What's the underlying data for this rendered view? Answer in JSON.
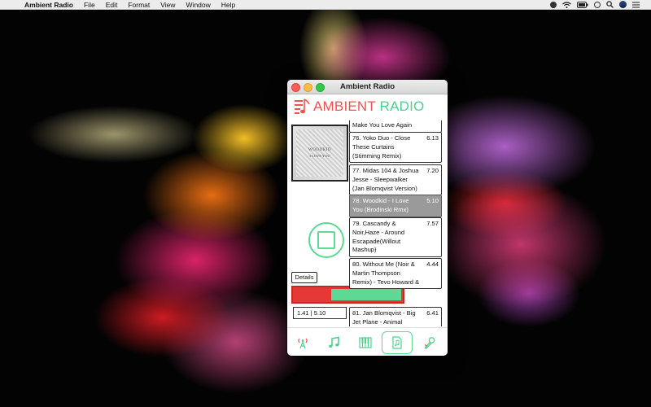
{
  "menubar": {
    "apple_glyph": "",
    "app_name": "Ambient Radio",
    "items": [
      "File",
      "Edit",
      "Format",
      "View",
      "Window",
      "Help"
    ]
  },
  "window": {
    "title": "Ambient Radio",
    "logo_word1": "AMBIENT",
    "logo_word2": "RADIO"
  },
  "player": {
    "album_art_artist": "WOODKID",
    "album_art_title": "I LOVE YOU",
    "details_label": "Details",
    "progress_fraction": 0.344,
    "time_display": "1.41 | 5.10"
  },
  "tracks": [
    {
      "title": "Make You Love Again",
      "length": ""
    },
    {
      "title": "76. Yoko Duo - Close These Curtains (Stimming Remix)",
      "length": "6.13"
    },
    {
      "title": "77. Midas 104 & Joshua Jesse - Sleepwalker (Jan Blomqvist Version)",
      "length": "7.20"
    },
    {
      "title": "78. Woodkid - I Love You (Brodinski Rmx)",
      "length": "5.10",
      "active": true
    },
    {
      "title": "79. Cascandy & Noir,Haze - Around Escapade(Willout Mashup)",
      "length": "7.57"
    },
    {
      "title": "80. Without Me (Noir & Martin Thompson Remix) - Tevo Howard &",
      "length": "4.44"
    },
    {
      "title": "81. Jan Blomqvist - Big Jet Plane - Animal",
      "length": "6.41"
    }
  ],
  "colors": {
    "accent_green": "#5fd894",
    "accent_red": "#e53935",
    "logo_red": "#ef5350",
    "logo_green": "#4fd18f"
  },
  "toolbar_icons": [
    "radio-tower-icon",
    "music-note-icon",
    "piano-icon",
    "music-file-icon",
    "microphone-icon"
  ]
}
